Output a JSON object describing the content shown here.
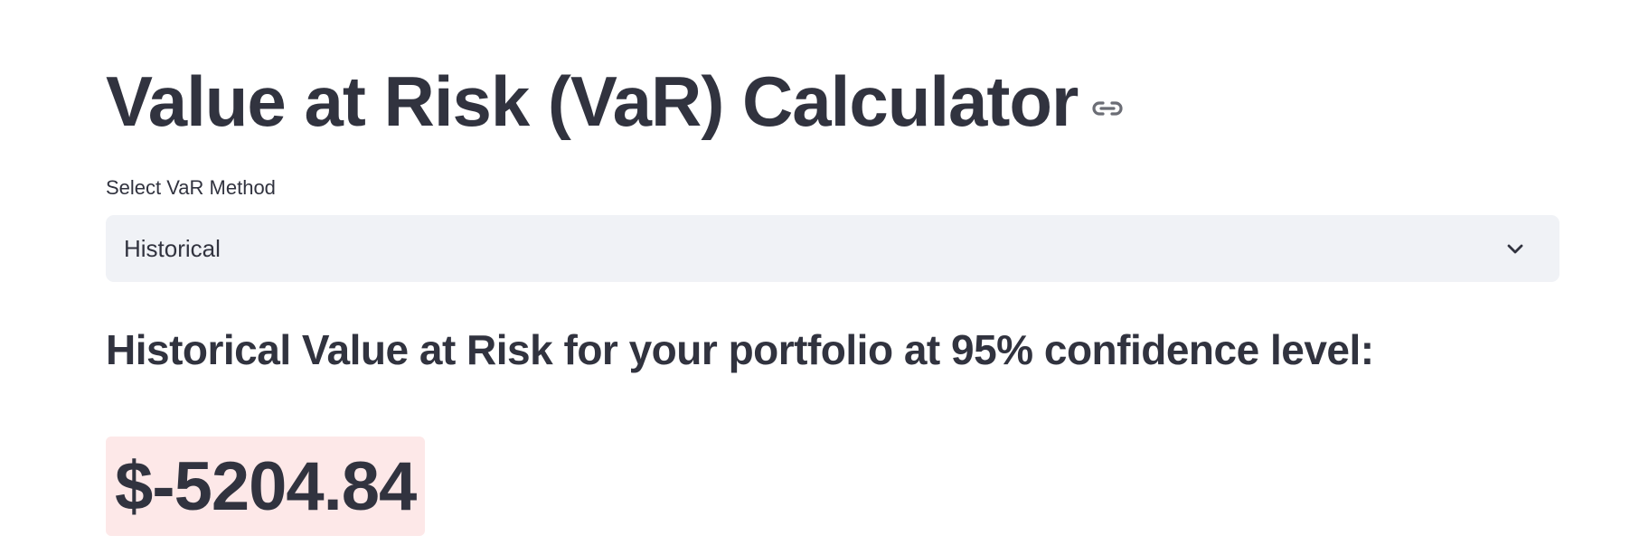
{
  "header": {
    "title": "Value at Risk (VaR) Calculator",
    "link_icon": "link-icon"
  },
  "method_select": {
    "label": "Select VaR Method",
    "selected": "Historical",
    "chevron_icon": "chevron-down-icon"
  },
  "result": {
    "heading": "Historical Value at Risk for your portfolio at 95% confidence level:",
    "value": "$-5204.84",
    "highlight_color": "#fde8e8"
  },
  "colors": {
    "text": "#31333f",
    "select_bg": "#f0f2f6"
  }
}
